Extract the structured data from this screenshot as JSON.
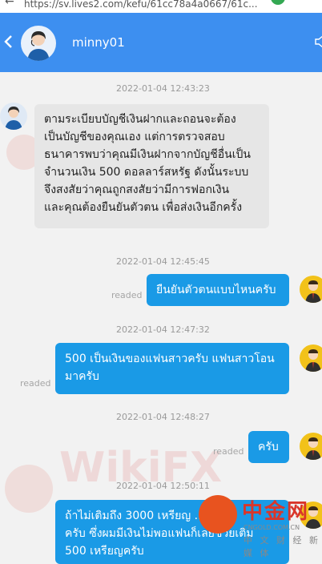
{
  "browser": {
    "url": "https://sv.lives2.com/kefu/61cc78a4a0667/61c..."
  },
  "header": {
    "agent_name": "minny01",
    "accent_color": "#3d8ff0"
  },
  "messages": [
    {
      "timestamp": "2022-01-04 12:43:23",
      "direction": "in",
      "lines": [
        "ตามระเบียบบัญชีเงินฝากและถอนจะต้อง",
        "เป็นบัญชีของคุณเอง แต่การตรวจสอบ",
        "ธนาคารพบว่าคุณมีเงินฝากจากบัญชีอื่นเป็น",
        "จำนวนเงิน 500 ดอลลาร์สหรัฐ ดังนั้นระบบ",
        "จึงสงสัยว่าคุณถูกสงสัยว่ามีการฟอกเงิน",
        "และคุณต้องยืนยันตัวตน เพื่อส่งเงินอีกครั้ง"
      ]
    },
    {
      "timestamp": "2022-01-04 12:45:45",
      "direction": "out",
      "status": "readed",
      "lines": [
        "ยืนยันตัวตนแบบไหนครับ"
      ]
    },
    {
      "timestamp": "2022-01-04 12:47:32",
      "direction": "out",
      "status": "readed",
      "lines": [
        "500 เป็นเงินของแฟนสาวครับ แฟนสาวโอน",
        "มาครับ"
      ]
    },
    {
      "timestamp": "2022-01-04 12:48:27",
      "direction": "out",
      "status": "readed",
      "lines": [
        "ครับ"
      ]
    },
    {
      "timestamp": "2022-01-04 12:50:11",
      "direction": "out",
      "lines": [
        "ถ้าไม่เติมถึง 3000 เหรียญ ...",
        "ครับ ซึ่งผมมีเงินไม่พอแฟนก็เลยช่วยเติม",
        "500 เหรียญครับ"
      ]
    }
  ],
  "watermarks": [
    "WikiFX",
    "WikiFX"
  ],
  "brand": {
    "logo_text": "中金网",
    "domain": "CNGOLD.COM.CN",
    "tagline": "中 文 财 经 新 媒 体"
  }
}
